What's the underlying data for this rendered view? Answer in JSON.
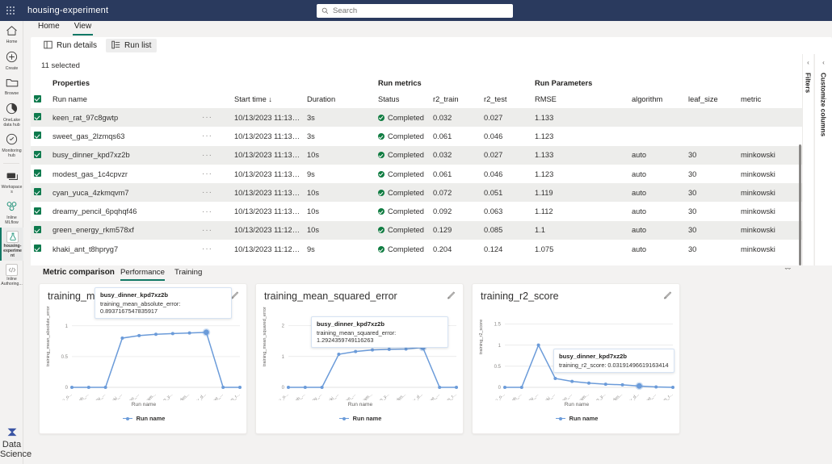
{
  "topbar": {
    "waffle_label": "app-launcher",
    "app_title": "housing-experiment",
    "search_placeholder": "Search",
    "search_value": ""
  },
  "rail": {
    "items": [
      {
        "label": "Home",
        "icon": "home-icon"
      },
      {
        "label": "Create",
        "icon": "plus-circle-icon"
      },
      {
        "label": "Browse",
        "icon": "folder-icon"
      },
      {
        "label": "OneLake data hub",
        "icon": "onelake-icon"
      },
      {
        "label": "Monitoring hub",
        "icon": "monitoring-icon"
      },
      {
        "label": "Workspaces",
        "icon": "workspaces-icon"
      },
      {
        "label": "Inline MLflow",
        "icon": "mlflow-icon"
      },
      {
        "label": "housing-experiment",
        "icon": "experiment-icon",
        "active": true
      },
      {
        "label": "Inline Authoring...",
        "icon": "code-icon"
      }
    ],
    "bottom": {
      "label": "Data Science",
      "icon": "data-science-icon"
    }
  },
  "ribbon": {
    "tabs": [
      {
        "label": "Home",
        "active": false
      },
      {
        "label": "View",
        "active": true
      }
    ],
    "buttons": [
      {
        "label": "Run details",
        "icon": "run-details-icon",
        "selected": false
      },
      {
        "label": "Run list",
        "icon": "run-list-icon",
        "selected": true
      }
    ]
  },
  "table": {
    "selected_text": "11 selected",
    "group_headers": [
      {
        "label": "Properties",
        "col": 1
      },
      {
        "label": "Run metrics",
        "col": 5
      },
      {
        "label": "Run Parameters",
        "col": 8
      }
    ],
    "columns": [
      "Run name",
      "",
      "Start time",
      "Duration",
      "Status",
      "r2_train",
      "r2_test",
      "RMSE",
      "algorithm",
      "leaf_size",
      "metric"
    ],
    "sort_column": "Start time",
    "sort_arrow": "↓",
    "rows": [
      {
        "checked": true,
        "run_name": "keen_rat_97c8gwtp",
        "more": "···",
        "start_time": "10/13/2023 11:13 AM",
        "duration": "3s",
        "status": "Completed",
        "r2_train": "0.032",
        "r2_test": "0.027",
        "rmse": "1.133",
        "algorithm": "",
        "leaf_size": "",
        "metric": ""
      },
      {
        "checked": true,
        "run_name": "sweet_gas_2lzmqs63",
        "more": "···",
        "start_time": "10/13/2023 11:13 AM",
        "duration": "3s",
        "status": "Completed",
        "r2_train": "0.061",
        "r2_test": "0.046",
        "rmse": "1.123",
        "algorithm": "",
        "leaf_size": "",
        "metric": ""
      },
      {
        "checked": true,
        "run_name": "busy_dinner_kpd7xz2b",
        "more": "···",
        "start_time": "10/13/2023 11:13 AM",
        "duration": "10s",
        "status": "Completed",
        "r2_train": "0.032",
        "r2_test": "0.027",
        "rmse": "1.133",
        "algorithm": "auto",
        "leaf_size": "30",
        "metric": "minkowski"
      },
      {
        "checked": true,
        "run_name": "modest_gas_1c4cpvzr",
        "more": "···",
        "start_time": "10/13/2023 11:13 AM",
        "duration": "9s",
        "status": "Completed",
        "r2_train": "0.061",
        "r2_test": "0.046",
        "rmse": "1.123",
        "algorithm": "auto",
        "leaf_size": "30",
        "metric": "minkowski"
      },
      {
        "checked": true,
        "run_name": "cyan_yuca_4zkmqvm7",
        "more": "···",
        "start_time": "10/13/2023 11:13 AM",
        "duration": "10s",
        "status": "Completed",
        "r2_train": "0.072",
        "r2_test": "0.051",
        "rmse": "1.119",
        "algorithm": "auto",
        "leaf_size": "30",
        "metric": "minkowski"
      },
      {
        "checked": true,
        "run_name": "dreamy_pencil_6pqhqf46",
        "more": "···",
        "start_time": "10/13/2023 11:13 AM",
        "duration": "10s",
        "status": "Completed",
        "r2_train": "0.092",
        "r2_test": "0.063",
        "rmse": "1.112",
        "algorithm": "auto",
        "leaf_size": "30",
        "metric": "minkowski"
      },
      {
        "checked": true,
        "run_name": "green_energy_rkm578xf",
        "more": "···",
        "start_time": "10/13/2023 11:12 AM",
        "duration": "10s",
        "status": "Completed",
        "r2_train": "0.129",
        "r2_test": "0.085",
        "rmse": "1.1",
        "algorithm": "auto",
        "leaf_size": "30",
        "metric": "minkowski"
      },
      {
        "checked": true,
        "run_name": "khaki_ant_t8hpryg7",
        "more": "···",
        "start_time": "10/13/2023 11:12 AM",
        "duration": "9s",
        "status": "Completed",
        "r2_train": "0.204",
        "r2_test": "0.124",
        "rmse": "1.075",
        "algorithm": "auto",
        "leaf_size": "30",
        "metric": "minkowski"
      }
    ]
  },
  "side_panes": [
    {
      "label": "Filters",
      "chevron": "‹"
    },
    {
      "label": "Customize columns",
      "chevron": "‹"
    }
  ],
  "metric_comparison": {
    "title": "Metric comparison",
    "tabs": [
      {
        "label": "Performance",
        "active": true
      },
      {
        "label": "Training",
        "active": false
      }
    ],
    "collapse_icon": "ˇˇ"
  },
  "chart_data": [
    {
      "type": "line",
      "title": "training_mean_absolute_error",
      "xlabel": "Run name",
      "ylabel": "training_mean_absolute_error",
      "legend": [
        "Run name"
      ],
      "legend_position": "bottom",
      "grid": true,
      "ylim": [
        0,
        1.18
      ],
      "yticks": [
        0,
        0.5,
        1
      ],
      "ytick_labels": [
        "0",
        "0.5",
        "1"
      ],
      "categories": [
        "ashy_o...",
        "tough_...",
        "happy_...",
        "khaki_...",
        "green_...",
        "dream...",
        "cyan_y...",
        "modes...",
        "busy_d...",
        "sweet_...",
        "keen_r..."
      ],
      "values": [
        0,
        0,
        0,
        0.8,
        0.84,
        0.862,
        0.873,
        0.884,
        0.8937,
        0,
        0
      ],
      "tooltip": {
        "name": "busy_dinner_kpd7xz2b",
        "metric": "training_mean_absolute_error",
        "value": "0.8937167547835917",
        "point_index": 8
      },
      "edit_icon": "pencil-icon"
    },
    {
      "type": "line",
      "title": "training_mean_squared_error",
      "xlabel": "Run name",
      "ylabel": "training_mean_squared_error",
      "legend": [
        "Run name"
      ],
      "legend_position": "bottom",
      "grid": true,
      "ylim": [
        0,
        2.35
      ],
      "yticks": [
        0,
        1,
        2
      ],
      "ytick_labels": [
        "0",
        "1",
        "2"
      ],
      "categories": [
        "ashy_o...",
        "tough_...",
        "happy_...",
        "khaki_...",
        "green_...",
        "dream...",
        "cyan_y...",
        "modes...",
        "busy_d...",
        "sweet_...",
        "keen_r..."
      ],
      "values": [
        0,
        0,
        0,
        1.07,
        1.16,
        1.21,
        1.23,
        1.24,
        1.2924,
        0,
        0
      ],
      "tooltip": {
        "name": "busy_dinner_kpd7xz2b",
        "metric": "training_mean_squared_error",
        "value": "1.2924359749116263",
        "point_index": 8
      },
      "edit_icon": "pencil-icon"
    },
    {
      "type": "line",
      "title": "training_r2_score",
      "xlabel": "Run name",
      "ylabel": "training_r2_score",
      "legend": [
        "Run name"
      ],
      "legend_position": "bottom",
      "grid": true,
      "ylim": [
        0,
        1.72
      ],
      "yticks": [
        0,
        0.5,
        1,
        1.5
      ],
      "ytick_labels": [
        "0",
        "0.5",
        "1",
        "1.5"
      ],
      "categories": [
        "ashy_o...",
        "tough_...",
        "happy_...",
        "khaki_...",
        "green_...",
        "dream...",
        "cyan_y...",
        "modes...",
        "busy_d...",
        "sweet_...",
        "keen_r..."
      ],
      "values": [
        0,
        0,
        1.0,
        0.21,
        0.14,
        0.1,
        0.075,
        0.06,
        0.0319,
        0.01,
        0
      ],
      "tooltip": {
        "name": "busy_dinner_kpd7xz2b",
        "metric": "training_r2_score",
        "value": "0.03191496619163414",
        "point_index": 8
      },
      "edit_icon": "pencil-icon"
    }
  ],
  "colors": {
    "topbar": "#2a3a5e",
    "accent": "#117865",
    "series": "#6b9bd9",
    "status_ok": "#107c41",
    "checkbox": "#0e7a4d"
  }
}
